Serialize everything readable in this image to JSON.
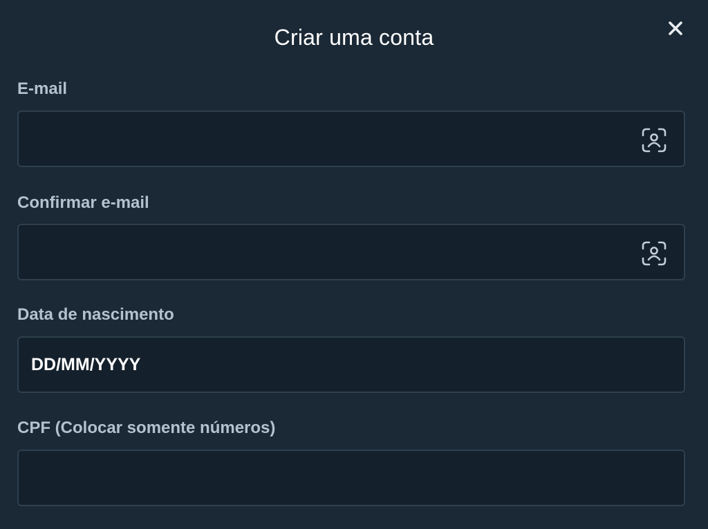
{
  "modal": {
    "title": "Criar uma conta",
    "close_icon": "close-icon"
  },
  "fields": {
    "email": {
      "label": "E-mail",
      "value": "",
      "placeholder": "",
      "icon": "person-scan-icon"
    },
    "confirm_email": {
      "label": "Confirmar e-mail",
      "value": "",
      "placeholder": "",
      "icon": "person-scan-icon"
    },
    "birth_date": {
      "label": "Data de nascimento",
      "value": "",
      "placeholder": "DD/MM/YYYY"
    },
    "cpf": {
      "label": "CPF (Colocar somente números)",
      "value": "",
      "placeholder": ""
    }
  },
  "colors": {
    "background": "#1b2936",
    "input_background": "#14202b",
    "input_border": "#2f3f4d",
    "label": "#b4c2d0",
    "title": "#ffffff"
  }
}
